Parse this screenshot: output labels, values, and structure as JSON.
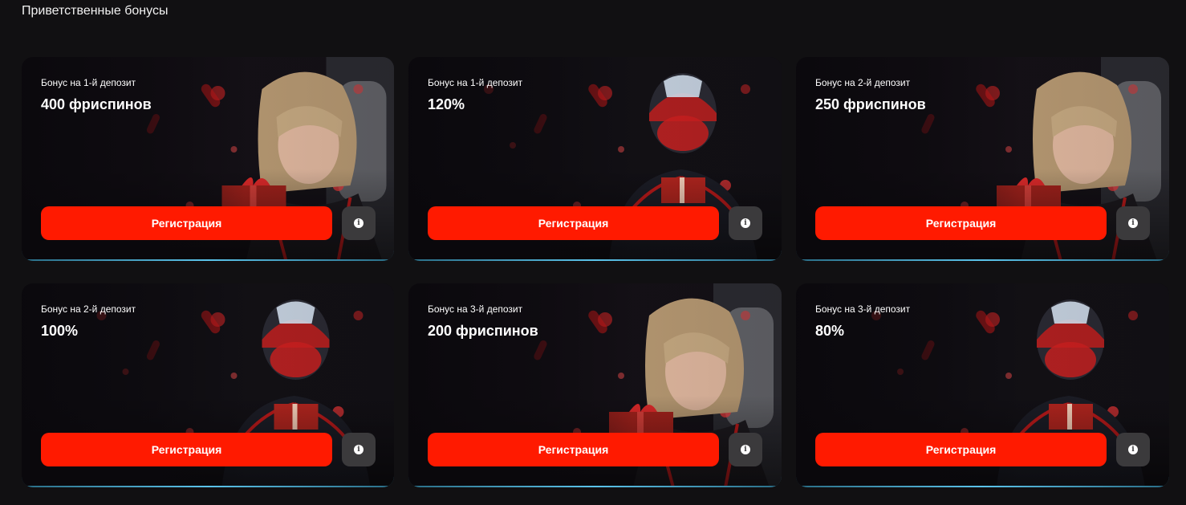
{
  "section_title": "Приветственные бонусы",
  "cards": [
    {
      "label": "Бонус на 1-й депозит",
      "amount": "400 фриспинов",
      "button": "Регистрация",
      "art": "girl-with-gift"
    },
    {
      "label": "Бонус на 1-й депозит",
      "amount": "120%",
      "button": "Регистрация",
      "art": "helmet-rider-with-gift"
    },
    {
      "label": "Бонус на 2-й депозит",
      "amount": "250 фриспинов",
      "button": "Регистрация",
      "art": "girl-with-gift"
    },
    {
      "label": "Бонус на 2-й депозит",
      "amount": "100%",
      "button": "Регистрация",
      "art": "helmet-rider-with-gift"
    },
    {
      "label": "Бонус на 3-й депозит",
      "amount": "200 фриспинов",
      "button": "Регистрация",
      "art": "girl-with-gift"
    },
    {
      "label": "Бонус на 3-й депозит",
      "amount": "80%",
      "button": "Регистрация",
      "art": "helmet-rider-with-gift"
    }
  ],
  "info_icon": "info-icon",
  "colors": {
    "background": "#111012",
    "button": "#ff1a00",
    "info_button": "#3b3a3c",
    "card_border": "#5bc3ea"
  }
}
